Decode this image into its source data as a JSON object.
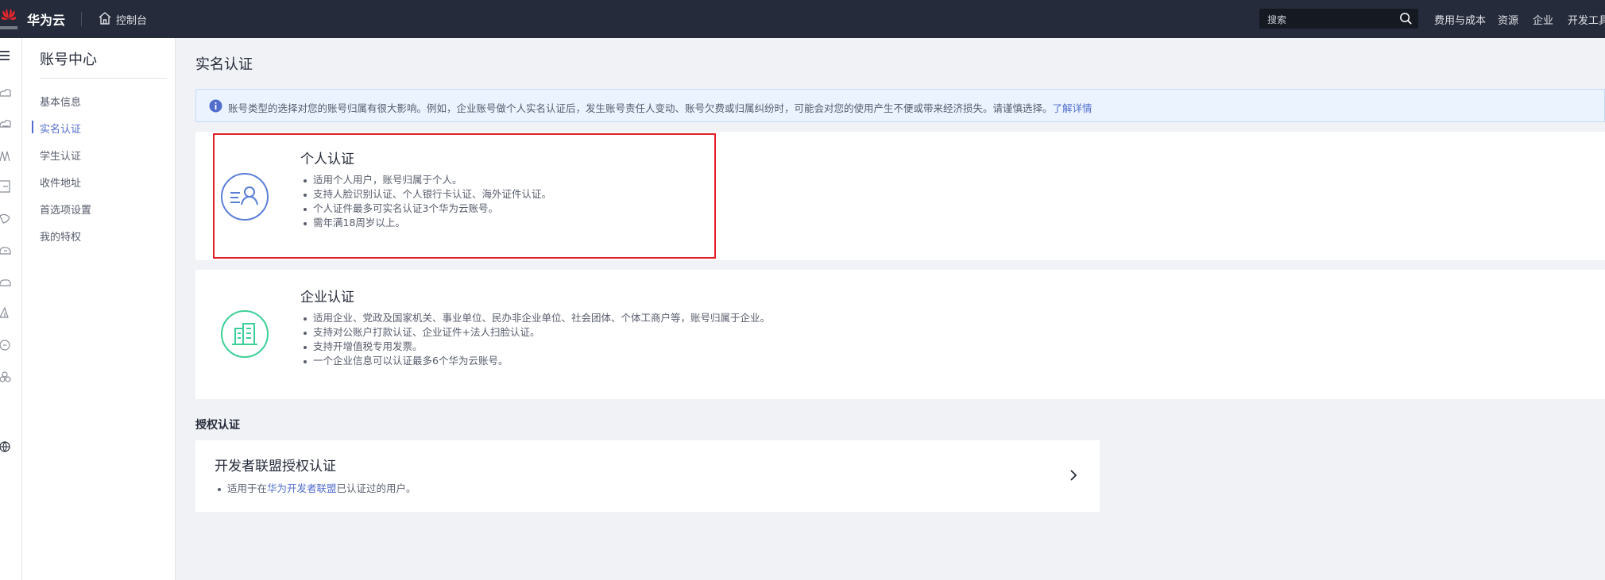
{
  "topbar": {
    "brand": "华为云",
    "console": "控制台",
    "search_placeholder": "搜索",
    "nav": [
      "费用与成本",
      "资源",
      "企业",
      "开发工具"
    ]
  },
  "menu": {
    "title": "账号中心",
    "items": [
      {
        "label": "基本信息",
        "active": false
      },
      {
        "label": "实名认证",
        "active": true
      },
      {
        "label": "学生认证",
        "active": false
      },
      {
        "label": "收件地址",
        "active": false
      },
      {
        "label": "首选项设置",
        "active": false
      },
      {
        "label": "我的特权",
        "active": false
      }
    ]
  },
  "main": {
    "title": "实名认证",
    "notice": {
      "text": "账号类型的选择对您的账号归属有很大影响。例如，企业账号做个人实名认证后，发生账号责任人变动、账号欠费或归属纠纷时，可能会对您的使用产生不便或带来经济损失。请谨慎选择。",
      "link": "了解详情"
    },
    "personal": {
      "title": "个人认证",
      "bullets": [
        "适用个人用户，账号归属于个人。",
        "支持人脸识别认证、个人银行卡认证、海外证件认证。",
        "个人证件最多可实名认证3个华为云账号。",
        "需年满18周岁以上。"
      ]
    },
    "enterprise": {
      "title": "企业认证",
      "bullets": [
        "适用企业、党政及国家机关、事业单位、民办非企业单位、社会团体、个体工商户等，账号归属于企业。",
        "支持对公账户打款认证、企业证件+法人扫脸认证。",
        "支持开增值税专用发票。",
        "一个企业信息可以认证最多6个华为云账号。"
      ]
    },
    "auth_section_title": "授权认证",
    "developer": {
      "title": "开发者联盟授权认证",
      "bullet_prefix": "适用于在",
      "bullet_link": "华为开发者联盟",
      "bullet_suffix": "已认证过的用户。"
    }
  },
  "colors": {
    "topbar_bg": "#252b3a",
    "accent_blue": "#526ecc",
    "personal_icon": "#5b7fd6",
    "enterprise_icon": "#3ccf96",
    "highlight_red": "#e0202a"
  }
}
